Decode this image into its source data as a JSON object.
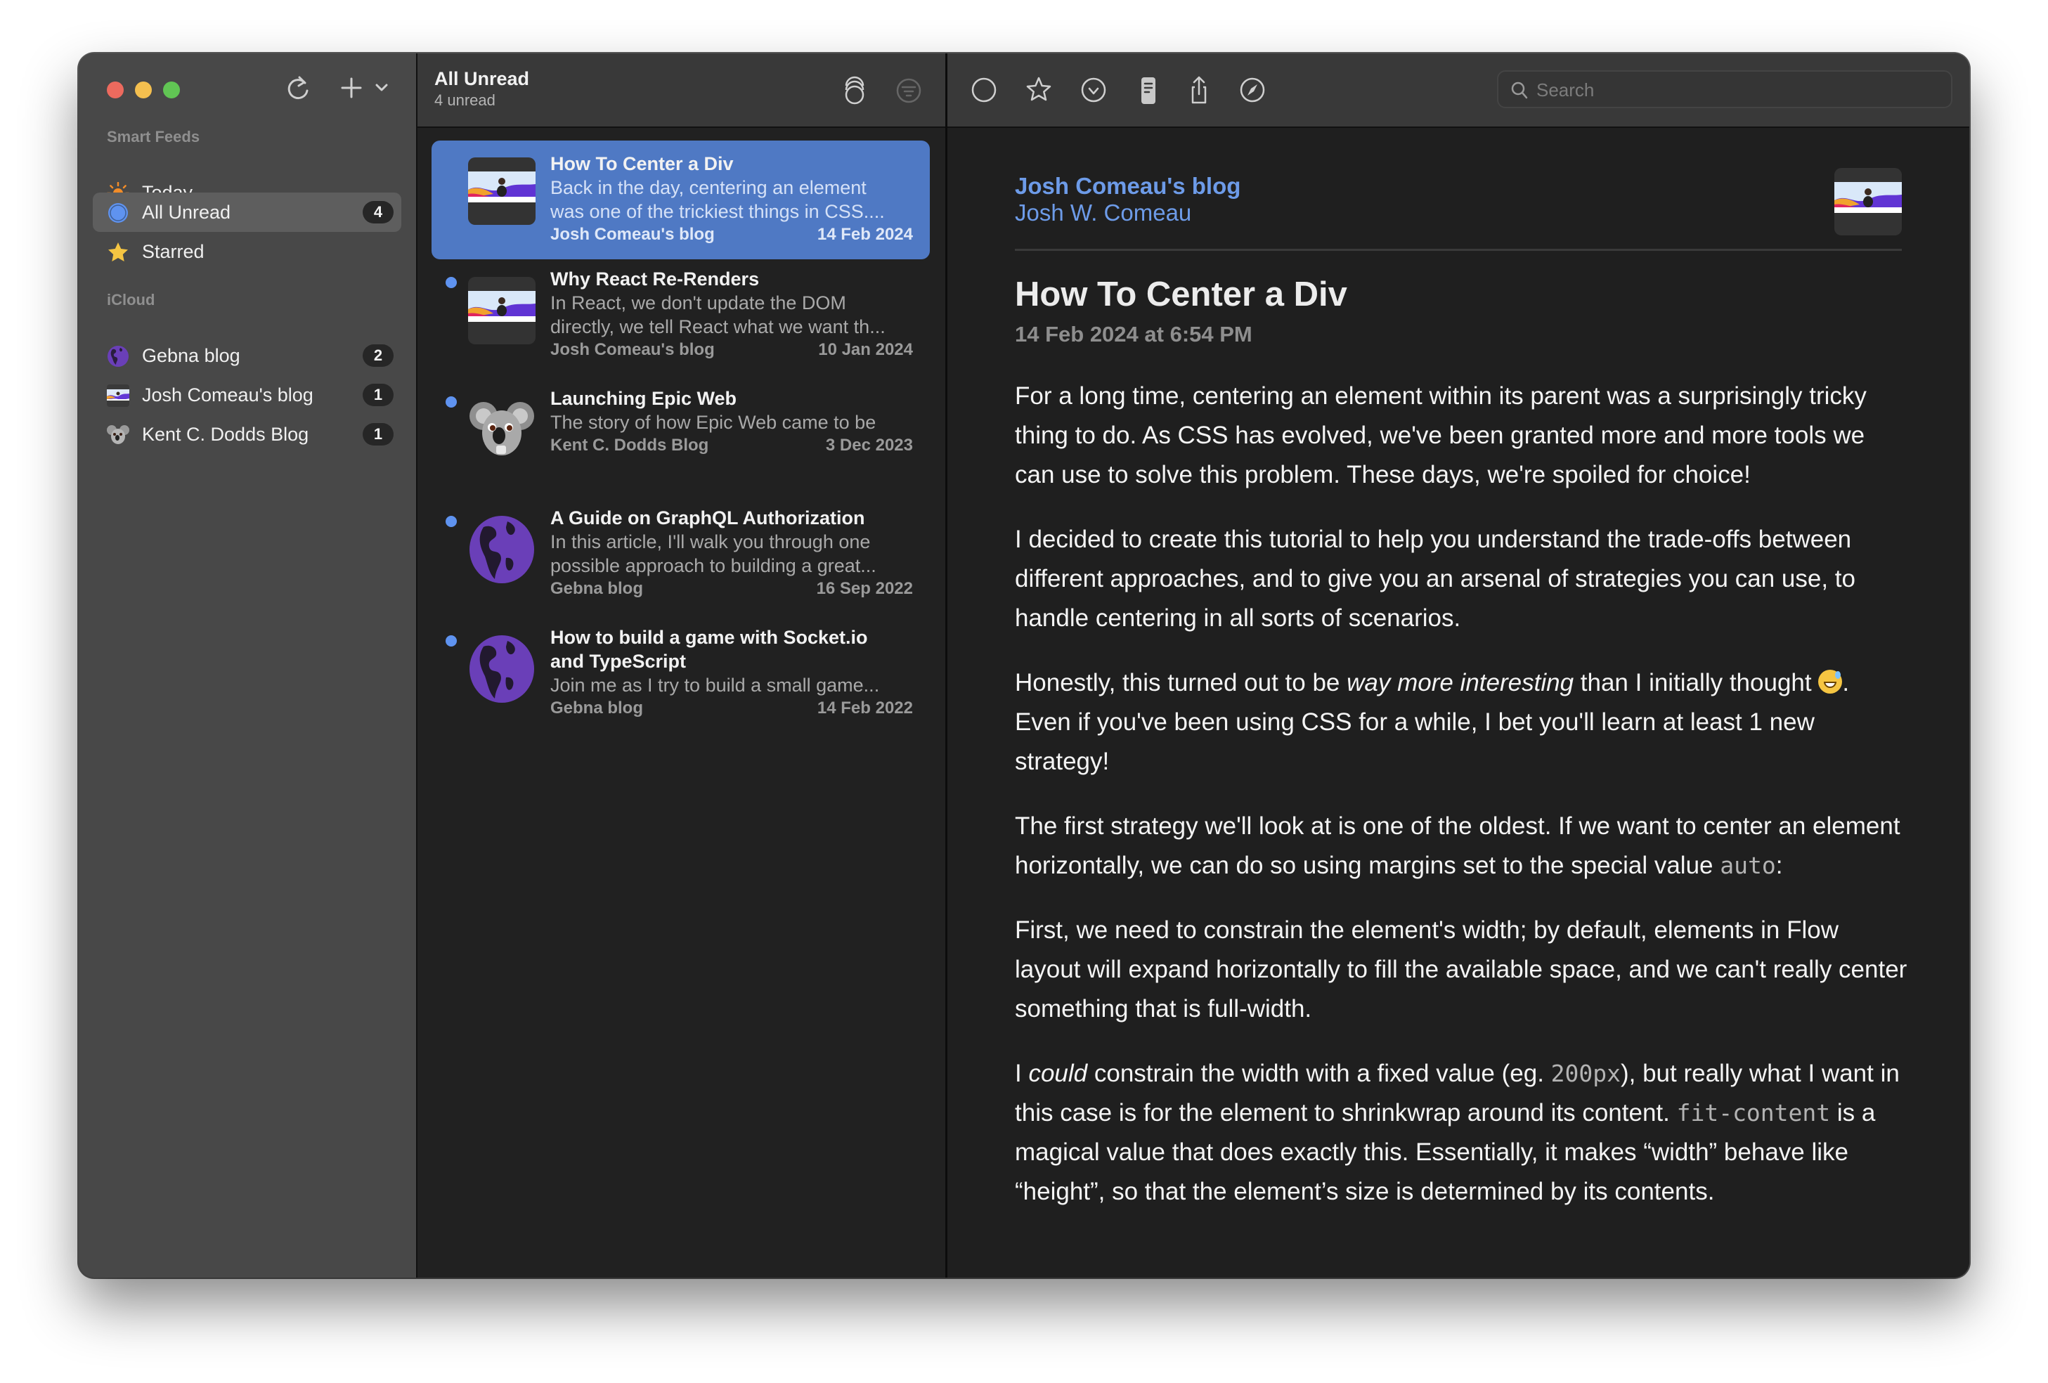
{
  "window": {
    "controls": [
      "close",
      "minimize",
      "maximize"
    ]
  },
  "sidebar": {
    "toolbar": {
      "refresh_icon": "refresh-icon",
      "add_icon": "plus-icon",
      "add_menu_icon": "chevron-down-icon"
    },
    "sections": [
      {
        "title": "Smart Feeds",
        "items": [
          {
            "label": "Today",
            "icon": "sun-icon",
            "badge": null,
            "selected": false
          },
          {
            "label": "All Unread",
            "icon": "unread-circle-icon",
            "badge": "4",
            "selected": true
          },
          {
            "label": "Starred",
            "icon": "star-icon",
            "badge": null,
            "selected": false
          }
        ]
      },
      {
        "title": "iCloud",
        "items": [
          {
            "label": "Gebna blog",
            "icon": "globe-icon",
            "badge": "2",
            "selected": false
          },
          {
            "label": "Josh Comeau's blog",
            "icon": "josh-comeau-favicon",
            "badge": "1",
            "selected": false
          },
          {
            "label": "Kent C. Dodds Blog",
            "icon": "koala-favicon",
            "badge": "1",
            "selected": false
          }
        ]
      }
    ]
  },
  "list": {
    "title": "All Unread",
    "subtitle": "4 unread",
    "header_icons": [
      "mark-all-read-icon",
      "filter-icon"
    ],
    "articles": [
      {
        "title": "How To Center a Div",
        "summary_lines": [
          "Back in the day, centering an element",
          "was one of the trickiest things in CSS...."
        ],
        "feed": "Josh Comeau's blog",
        "date": "14 Feb 2024",
        "unread": false,
        "selected": true,
        "thumb": "josh"
      },
      {
        "title": "Why React Re-Renders",
        "summary_lines": [
          "In React, we don't update the DOM",
          "directly, we tell React what we want th..."
        ],
        "feed": "Josh Comeau's blog",
        "date": "10 Jan 2024",
        "unread": true,
        "selected": false,
        "thumb": "josh"
      },
      {
        "title": "Launching Epic Web",
        "summary_lines": [
          "The story of how Epic Web came to be"
        ],
        "feed": "Kent C. Dodds Blog",
        "date": "3 Dec 2023",
        "unread": true,
        "selected": false,
        "thumb": "koala"
      },
      {
        "title": "A Guide on GraphQL Authorization",
        "summary_lines": [
          "In this article, I'll walk you through one",
          "possible approach to building a great..."
        ],
        "feed": "Gebna blog",
        "date": "16 Sep 2022",
        "unread": true,
        "selected": false,
        "thumb": "globe"
      },
      {
        "title_lines": [
          "How to build a game with Socket.io",
          "and TypeScript"
        ],
        "title": "How to build a game with Socket.io and TypeScript",
        "summary_lines": [
          "Join me as I try to build a small game..."
        ],
        "feed": "Gebna blog",
        "date": "14 Feb 2022",
        "unread": true,
        "selected": false,
        "thumb": "globe"
      }
    ]
  },
  "reader": {
    "toolbar": {
      "buttons": [
        "mark-unread-icon",
        "star-icon",
        "mark-read-check-icon",
        "reader-view-icon",
        "share-icon",
        "open-in-browser-compass-icon"
      ],
      "search_placeholder": "Search"
    },
    "feed_name": "Josh Comeau's blog",
    "author": "Josh W. Comeau",
    "title": "How To Center a Div",
    "date": "14 Feb 2024 at 6:54 PM",
    "paragraphs": [
      {
        "segments": [
          {
            "t": "text",
            "v": "For a long time, centering an element within its parent was a surprisingly tricky thing to do. As CSS has evolved, we've been granted more and more tools we can use to solve this problem. These days, we're spoiled for choice!"
          }
        ]
      },
      {
        "segments": [
          {
            "t": "text",
            "v": "I decided to create this tutorial to help you understand the trade-offs between different approaches, and to give you an arsenal of strategies you can use, to handle centering in all sorts of scenarios."
          }
        ]
      },
      {
        "segments": [
          {
            "t": "text",
            "v": "Honestly, this turned out to be "
          },
          {
            "t": "em",
            "v": "way more interesting"
          },
          {
            "t": "text",
            "v": " than I initially thought "
          },
          {
            "t": "emoji",
            "v": "grinning-sweat-emoji"
          },
          {
            "t": "text",
            "v": ". Even if you've been using CSS for a while, I bet you'll learn at least 1 new strategy!"
          }
        ]
      },
      {
        "segments": [
          {
            "t": "text",
            "v": "The first strategy we'll look at is one of the oldest. If we want to center an element horizontally, we can do so using margins set to the special value "
          },
          {
            "t": "code",
            "v": "auto"
          },
          {
            "t": "text",
            "v": ":"
          }
        ]
      },
      {
        "segments": [
          {
            "t": "text",
            "v": "First, we need to constrain the element's width; by default, elements in Flow layout will expand horizontally to fill the available space, and we can't really center something that is full-width."
          }
        ]
      },
      {
        "segments": [
          {
            "t": "text",
            "v": "I "
          },
          {
            "t": "em",
            "v": "could"
          },
          {
            "t": "text",
            "v": " constrain the width with a fixed value (eg. "
          },
          {
            "t": "code",
            "v": "200px"
          },
          {
            "t": "text",
            "v": "), but really what I want in this case is for the element to shrinkwrap around its content. "
          },
          {
            "t": "code",
            "v": "fit-content"
          },
          {
            "t": "text",
            "v": " is a magical value that does exactly this. Essentially, it makes “width” behave like “height”, so that the element’s size is determined by its contents."
          }
        ]
      }
    ]
  },
  "colors": {
    "accent": "#4f79c4",
    "unread_dot": "#5f93f0",
    "link": "#6d9be8",
    "sidebar_bg": "#484848",
    "list_bg": "#212121",
    "reader_bg": "#1f1f1f"
  }
}
